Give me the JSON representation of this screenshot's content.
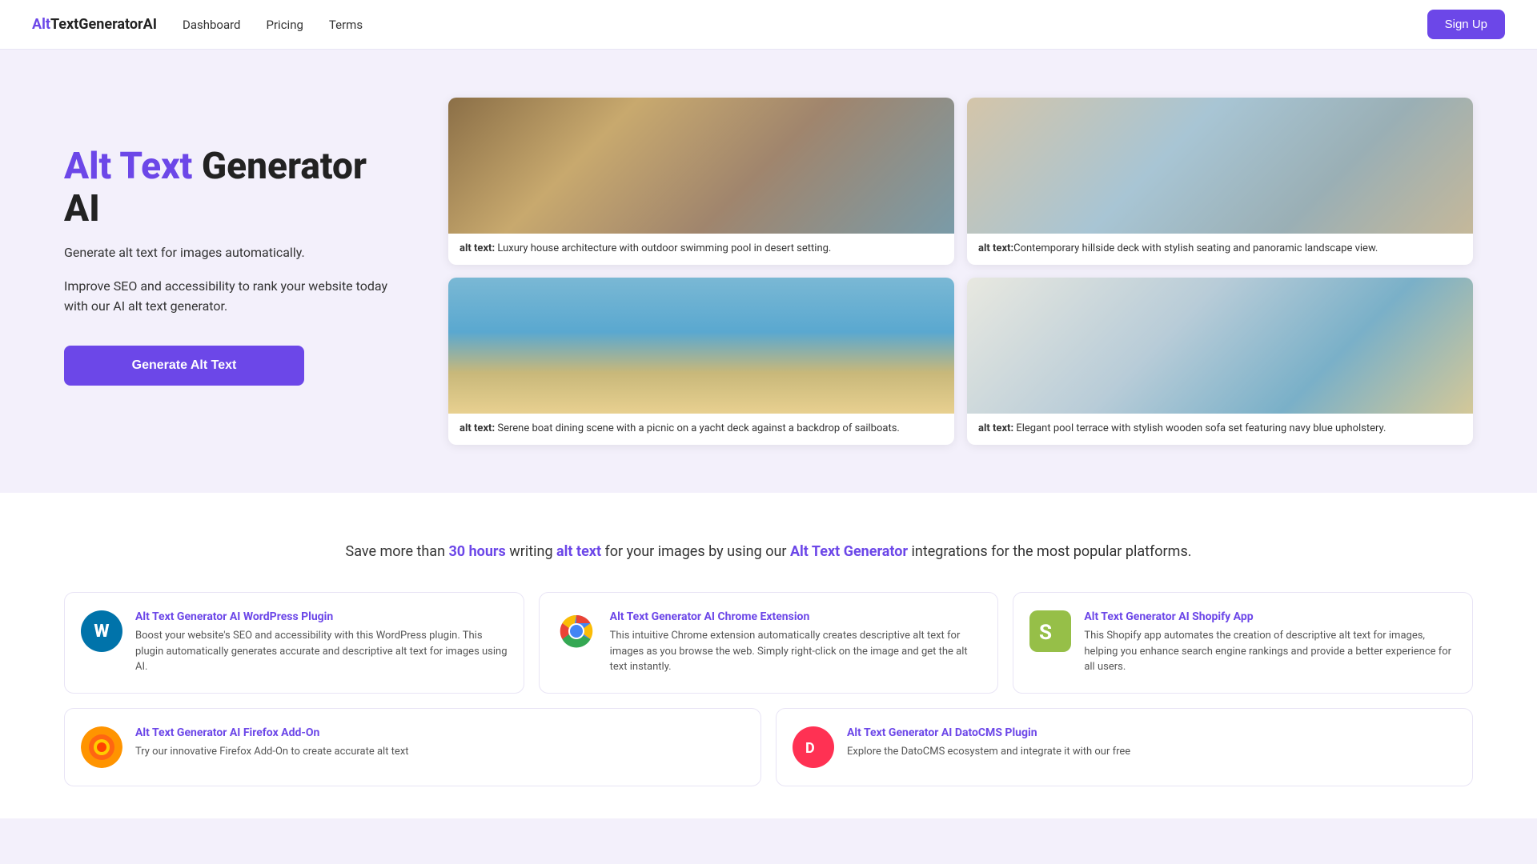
{
  "nav": {
    "logo_alt": "Alt",
    "logo_text": "Text",
    "logo_brand": "GeneratorAI",
    "links": [
      "Dashboard",
      "Pricing",
      "Terms"
    ],
    "signup_label": "Sign Up"
  },
  "hero": {
    "title_purple": "Alt Text",
    "title_black": " Generator AI",
    "subtitle": "Generate alt text for images automatically.",
    "description": "Improve SEO and accessibility to rank your website today with our AI alt text generator.",
    "cta_label": "Generate Alt Text"
  },
  "images": [
    {
      "caption_label": "alt text:",
      "caption_text": " Luxury house architecture with outdoor swimming pool in desert setting.",
      "class": "house1"
    },
    {
      "caption_label": "alt text:",
      "caption_text": "Contemporary hillside deck with stylish seating and panoramic landscape view.",
      "class": "house2"
    },
    {
      "caption_label": "alt text:",
      "caption_text": " Serene boat dining scene with a picnic on a yacht deck against a backdrop of sailboats.",
      "class": "boat"
    },
    {
      "caption_label": "alt text:",
      "caption_text": " Elegant pool terrace with stylish wooden sofa set featuring navy blue upholstery.",
      "class": "pool"
    }
  ],
  "integrations": {
    "headline_part1": "Save more than ",
    "hours": "30 hours",
    "headline_part2": " writing ",
    "alt_text": "alt text",
    "headline_part3": " for your images by using our ",
    "generator_link": "Alt Text Generator",
    "headline_part4": " integrations for the most popular platforms.",
    "cards": [
      {
        "icon_type": "wordpress",
        "title": "Alt Text Generator AI WordPress Plugin",
        "description": "Boost your website's SEO and accessibility with this WordPress plugin. This plugin automatically generates accurate and descriptive alt text for images using AI."
      },
      {
        "icon_type": "chrome",
        "title": "Alt Text Generator AI Chrome Extension",
        "description": "This intuitive Chrome extension automatically creates descriptive alt text for images as you browse the web. Simply right-click on the image and get the alt text instantly."
      },
      {
        "icon_type": "shopify",
        "title": "Alt Text Generator AI Shopify App",
        "description": "This Shopify app automates the creation of descriptive alt text for images, helping you enhance search engine rankings and provide a better experience for all users."
      }
    ],
    "cards2": [
      {
        "icon_type": "firefox",
        "title": "Alt Text Generator AI Firefox Add-On",
        "description": "Try our innovative Firefox Add-On to create accurate alt text"
      },
      {
        "icon_type": "datocms",
        "title": "Alt Text Generator AI DatoCMS Plugin",
        "description": "Explore the DatoCMS ecosystem and integrate it with our free"
      }
    ]
  }
}
